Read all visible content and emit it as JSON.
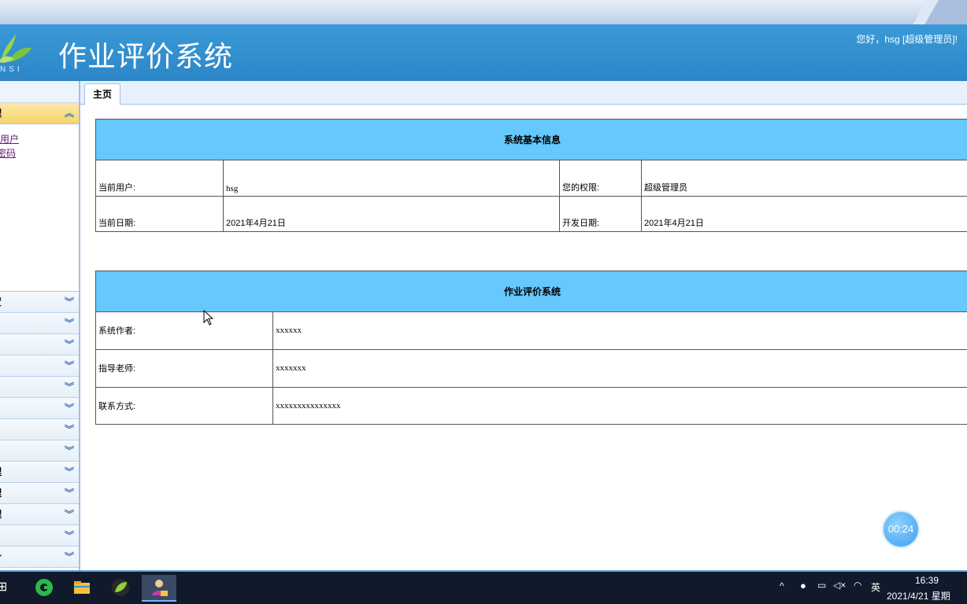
{
  "header": {
    "logo_text": "NSI",
    "app_title": "作业评价系统",
    "greeting": "您好，hsg [超级管理员]!"
  },
  "sidebar": {
    "active_group": "理",
    "links": [
      "员用户",
      "密码"
    ],
    "groups": [
      "置",
      "",
      "",
      "",
      "",
      "",
      "",
      "",
      "理",
      "理",
      "理",
      "",
      "计"
    ]
  },
  "tabs": {
    "home": "主页"
  },
  "sysinfo": {
    "title": "系统基本信息",
    "current_user_label": "当前用户:",
    "current_user": "hsg",
    "perm_label": "您的权限:",
    "perm": "超级管理员",
    "date_label": "当前日期:",
    "date": "2021年4月21日",
    "dev_date_label": "开发日期:",
    "dev_date": "2021年4月21日"
  },
  "about": {
    "title": "作业评价系统",
    "author_label": "系统作者:",
    "author": "xxxxxx",
    "teacher_label": "指导老师:",
    "teacher": "xxxxxxx",
    "contact_label": "联系方式:",
    "contact": "xxxxxxxxxxxxxxx"
  },
  "timer": "00:24",
  "taskbar": {
    "time": "16:39",
    "date": "2021/4/21 星期",
    "ime": "英",
    "start_glyph": "⊞"
  },
  "icons": [
    "edge-icon",
    "folder-icon",
    "leaf-app-icon",
    "user-app-icon",
    "qq-icon",
    "battery-icon",
    "mute-icon",
    "wifi-icon"
  ]
}
